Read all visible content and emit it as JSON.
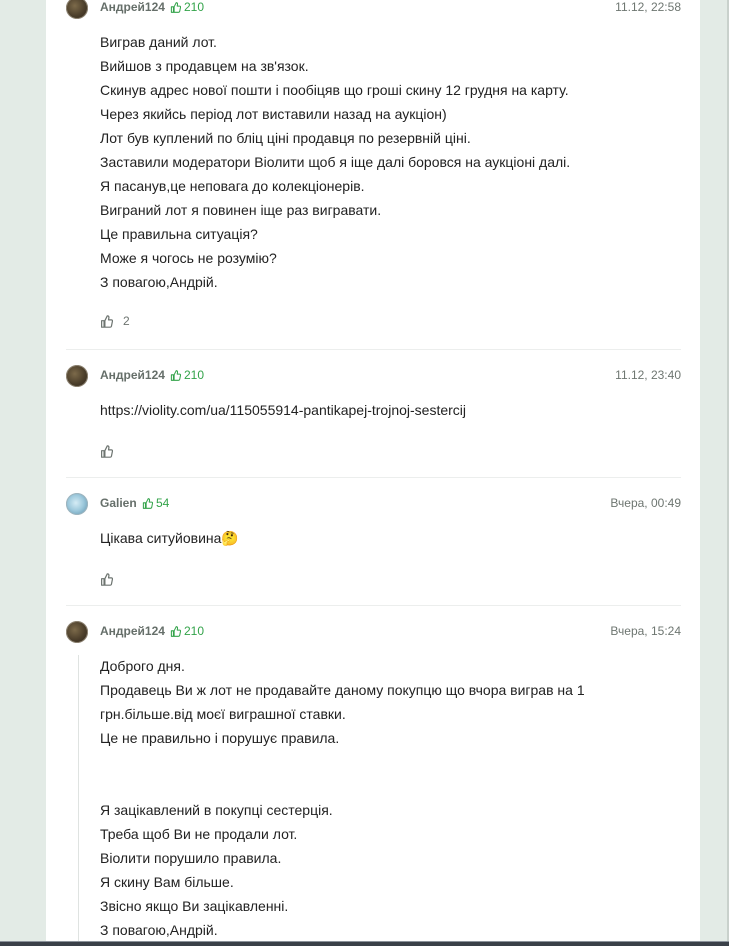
{
  "comments": [
    {
      "author": "Андрей124",
      "rating": "210",
      "date": "11.12, 22:58",
      "lines": [
        "Виграв даний лот.",
        "Вийшов з продавцем на зв'язок.",
        "Скинув адрес нової пошти і пообіцяв що гроші скину 12 грудня на карту.",
        "Через якийсь період лот виставили назад на аукціон)",
        "Лот був куплений по бліц ціні продавця по резервній ціні.",
        "Заставили модератори Віолити щоб я іще далі боровся на аукціоні далі.",
        "Я пасанув,це неповага до колекціонерів.",
        "Виграний лот я повинен іще раз вигравати.",
        "Це правильна ситуація?",
        "Може я чогось не розумію?",
        "З повагою,Андрій."
      ],
      "likes": "2"
    },
    {
      "author": "Андрей124",
      "rating": "210",
      "date": "11.12, 23:40",
      "lines": [
        "https://violity.com/ua/115055914-pantikapej-trojnoj-sestercij"
      ],
      "likes": ""
    },
    {
      "author": "Galien",
      "rating": "54",
      "date": "Вчера, 00:49",
      "lines": [
        "Цікава ситуйовина🤔"
      ],
      "likes": ""
    },
    {
      "author": "Андрей124",
      "rating": "210",
      "date": "Вчера, 15:24",
      "lines": [
        "Доброго дня.",
        "Продавець Ви ж лот не продавайте даному покупцю що вчора виграв на 1",
        "грн.більше.від моєї виграшної ставки.",
        "Це не правильно і порушує правила.",
        "",
        "",
        "Я зацікавлений в покупці сестерція.",
        "Треба щоб Ви не продали лот.",
        "Віолити порушило правила.",
        "Я скину Вам більше.",
        "Звісно якщо Ви зацікавленні.",
        "З повагою,Андрій."
      ],
      "likes": ""
    }
  ]
}
